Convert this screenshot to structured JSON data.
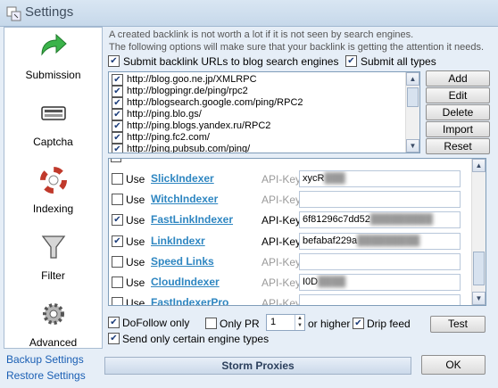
{
  "window": {
    "title": "Settings"
  },
  "sidebar": {
    "items": [
      {
        "label": "Submission",
        "icon": "green-arrow-icon"
      },
      {
        "label": "Captcha",
        "icon": "keyboard-icon"
      },
      {
        "label": "Indexing",
        "icon": "lifebuoy-icon"
      },
      {
        "label": "Filter",
        "icon": "funnel-icon"
      },
      {
        "label": "Advanced",
        "icon": "gears-icon"
      }
    ],
    "backup_link": "Backup Settings",
    "restore_link": "Restore Settings"
  },
  "info": {
    "line1": "A created backlink is not worth a lot if it is not seen by search engines.",
    "line2": "The following options will make sure that your backlink is getting the attention it needs."
  },
  "options": {
    "submit_blog_search": {
      "label": "Submit backlink URLs to blog search engines",
      "checked": true
    },
    "submit_all_types": {
      "label": "Submit all types",
      "checked": true
    }
  },
  "ping_urls": [
    "http://blog.goo.ne.jp/XMLRPC",
    "http://blogpingr.de/ping/rpc2",
    "http://blogsearch.google.com/ping/RPC2",
    "http://ping.blo.gs/",
    "http://ping.blogs.yandex.ru/RPC2",
    "http://ping.fc2.com/",
    "http://ping.pubsub.com/ping/"
  ],
  "url_buttons": {
    "add": "Add",
    "edit": "Edit",
    "delete": "Delete",
    "import": "Import",
    "reset": "Reset"
  },
  "indexers": {
    "use_label": "Use",
    "api_label": "API-Key",
    "rows": [
      {
        "name": "SlickIndexer",
        "checked": false,
        "api_key": "xycR",
        "api_enabled": false
      },
      {
        "name": "WitchIndexer",
        "checked": false,
        "api_key": "",
        "api_enabled": false
      },
      {
        "name": "FastLinkIndexer",
        "checked": true,
        "api_key": "6f81296c7dd52",
        "api_enabled": true
      },
      {
        "name": "LinkIndexr",
        "checked": true,
        "api_key": "befabaf229a",
        "api_enabled": true
      },
      {
        "name": "Speed Links",
        "checked": false,
        "api_key": "",
        "api_enabled": false
      },
      {
        "name": "CloudIndexer",
        "checked": false,
        "api_key": "I0D",
        "api_enabled": false
      },
      {
        "name": "FastIndexerPro",
        "checked": false,
        "api_key": "",
        "api_enabled": false
      }
    ]
  },
  "bottom_options": {
    "dofollow": {
      "label": "DoFollow only",
      "checked": true
    },
    "only_pr": {
      "label": "Only PR",
      "checked": false
    },
    "pr_value": "1",
    "or_higher": "or higher",
    "drip_feed": {
      "label": "Drip feed",
      "checked": true
    },
    "test_button": "Test",
    "engine_types": {
      "label": "Send only certain engine types",
      "checked": true
    }
  },
  "status_bar": {
    "text": "Storm Proxies"
  },
  "ok_button": "OK"
}
